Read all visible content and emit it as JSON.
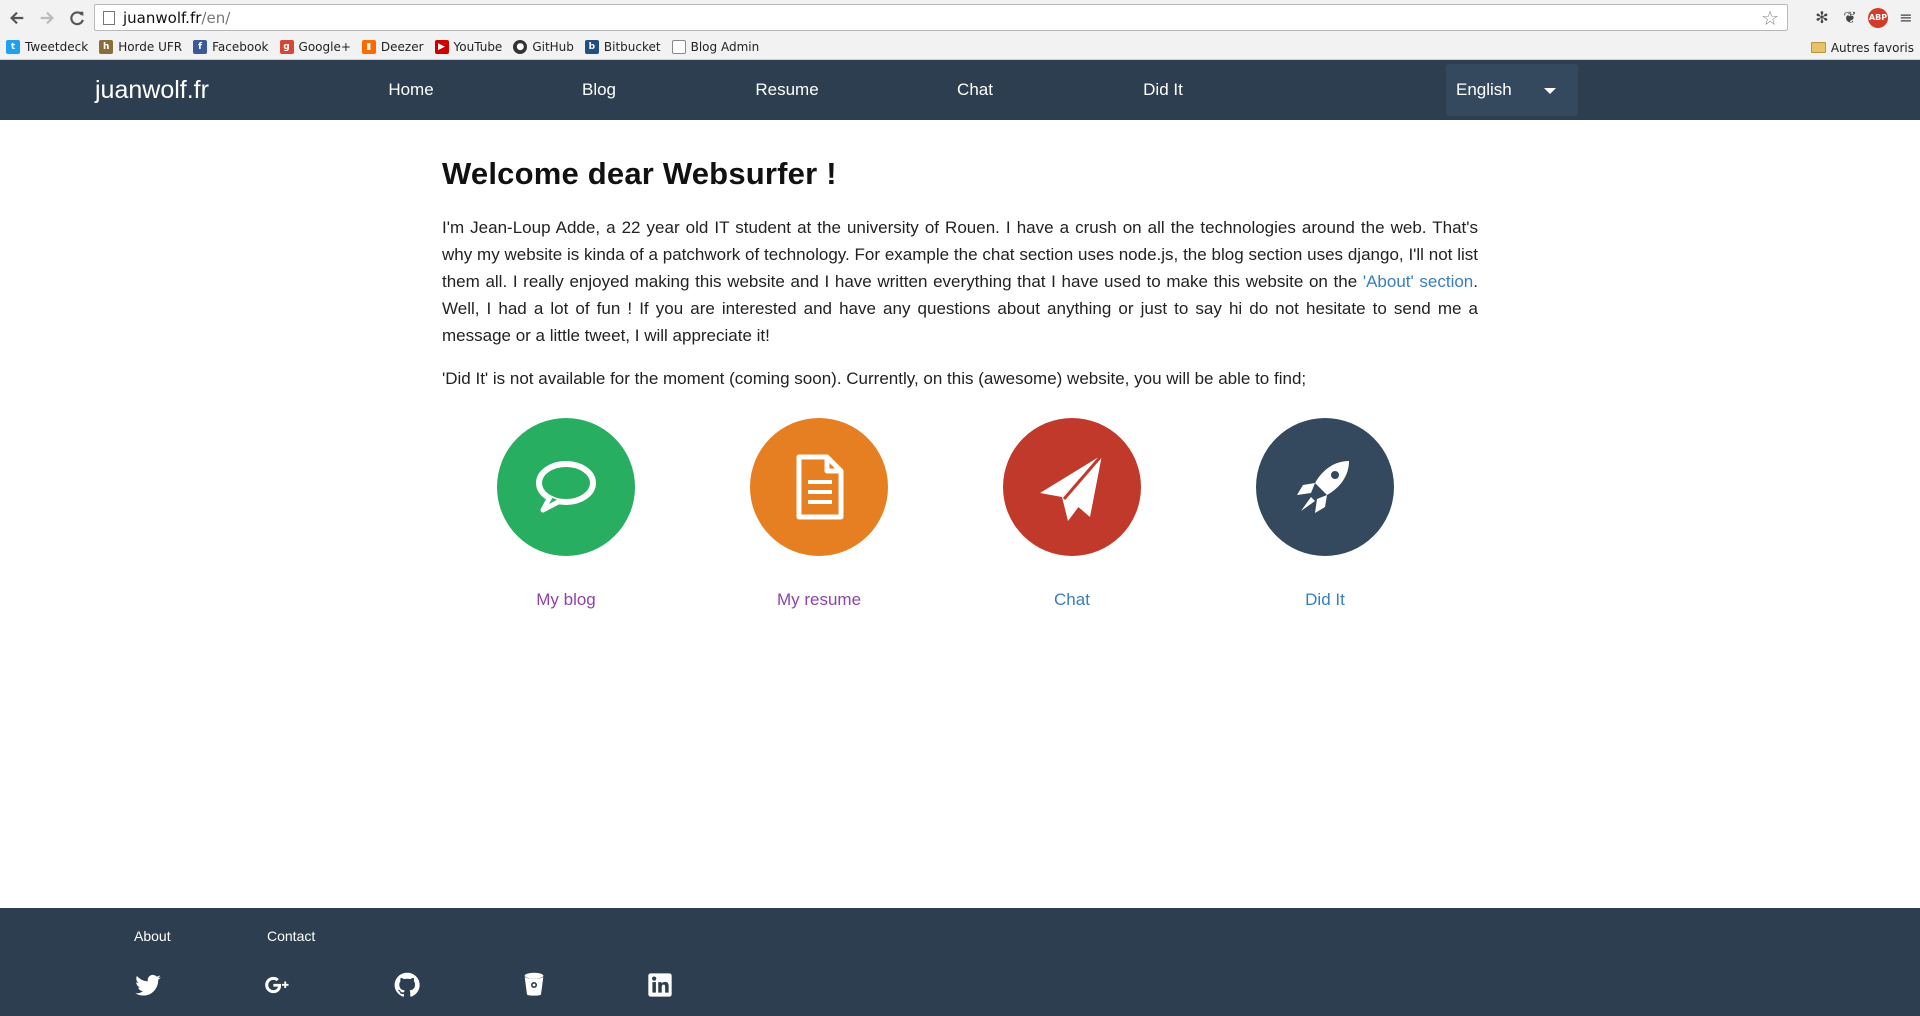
{
  "browser": {
    "url_host": "juanwolf.fr",
    "url_path": "/en/",
    "bookmarks": [
      {
        "label": "Tweetdeck",
        "icon": "twitter-bird-icon",
        "color": "#1da1f2"
      },
      {
        "label": "Horde UFR",
        "icon": "horde-icon",
        "color": "#8a6d3b"
      },
      {
        "label": "Facebook",
        "icon": "facebook-icon",
        "color": "#3b5998"
      },
      {
        "label": "Google+",
        "icon": "google-plus-icon",
        "color": "#d34836"
      },
      {
        "label": "Deezer",
        "icon": "deezer-icon",
        "color": "#ff0000"
      },
      {
        "label": "YouTube",
        "icon": "youtube-icon",
        "color": "#cc0000"
      },
      {
        "label": "GitHub",
        "icon": "github-icon",
        "color": "#333333"
      },
      {
        "label": "Bitbucket",
        "icon": "bitbucket-icon",
        "color": "#205081"
      },
      {
        "label": "Blog Admin",
        "icon": "page-icon",
        "color": "#ffffff"
      }
    ],
    "other_bookmarks": "Autres favoris",
    "abp_label": "ABP"
  },
  "nav": {
    "brand": "juanwolf.fr",
    "items": [
      "Home",
      "Blog",
      "Resume",
      "Chat",
      "Did It"
    ],
    "language": "English"
  },
  "main": {
    "title": "Welcome dear Websurfer !",
    "intro_before_link": "I'm Jean-Loup Adde, a 22 year old IT student at the university of Rouen. I have a crush on all the technologies around the web. That's why my website is kinda of a patchwork of technology. For example the chat section uses node.js, the blog section uses django, I'll not list them all. I really enjoyed making this website and I have written everything that I have used to make this website on the ",
    "about_link": "'About' section",
    "intro_after_link": ". Well, I had a lot of fun ! If you are interested and have any questions about anything or just to say hi do not hesitate to send me a message or a little tweet, I will appreciate it!",
    "note": "'Did It' is not available for the moment (coming soon). Currently, on this (awesome) website, you will be able to find;",
    "features": [
      {
        "label": "My blog",
        "icon": "speech-bubble-icon",
        "color": "#27ae60",
        "label_color": "#8e44ad"
      },
      {
        "label": "My resume",
        "icon": "document-icon",
        "color": "#e67e22",
        "label_color": "#8e44ad"
      },
      {
        "label": "Chat",
        "icon": "paper-plane-icon",
        "color": "#c0392b",
        "label_color": "#3a7dbf"
      },
      {
        "label": "Did It",
        "icon": "rocket-icon",
        "color": "#34495e",
        "label_color": "#3a7dbf"
      }
    ]
  },
  "footer": {
    "links": [
      "About",
      "Contact"
    ],
    "social": [
      "twitter-icon",
      "google-plus-icon",
      "github-icon",
      "bitbucket-icon",
      "linkedin-icon"
    ]
  },
  "colors": {
    "navbar_bg": "#2c3e50",
    "footer_bg": "#2c3e50",
    "language_bg": "#34495e",
    "link": "#3a7dbf"
  }
}
